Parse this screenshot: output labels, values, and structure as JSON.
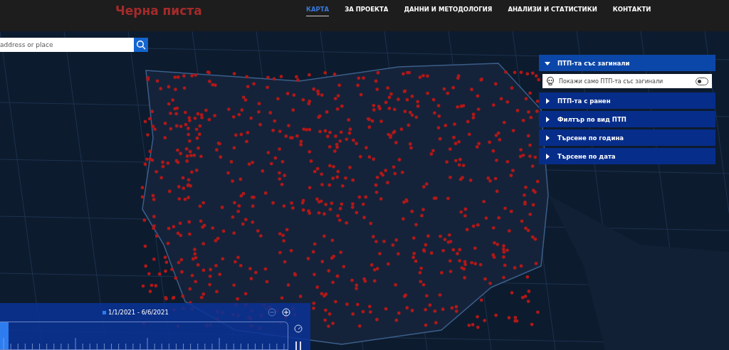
{
  "header": {
    "logo": "Черна писта",
    "nav": [
      {
        "label": "КАРТА",
        "selected": true
      },
      {
        "label": "ЗА ПРОЕКТА",
        "selected": false
      },
      {
        "label": "ДАННИ И МЕТОДОЛОГИЯ",
        "selected": false
      },
      {
        "label": "АНАЛИЗИ И СТАТИСТИКИ",
        "selected": false
      },
      {
        "label": "КОНТАКТИ",
        "selected": false
      }
    ]
  },
  "search": {
    "placeholder": "address or place"
  },
  "filters": [
    {
      "title": "ПТП-та със загинали",
      "expanded": true,
      "toggle": {
        "label": "Покажи само ПТП-та със загинали",
        "on": false
      }
    },
    {
      "title": "ПТП-та с ранен",
      "expanded": false
    },
    {
      "title": "Филтър по вид ПТП",
      "expanded": false
    },
    {
      "title": "Търсене по година",
      "expanded": false
    },
    {
      "title": "Търсене по дата",
      "expanded": false
    }
  ],
  "time_slider": {
    "range": "1/1/2021 - 6/6/2021",
    "level": 0.03,
    "playing": true
  }
}
